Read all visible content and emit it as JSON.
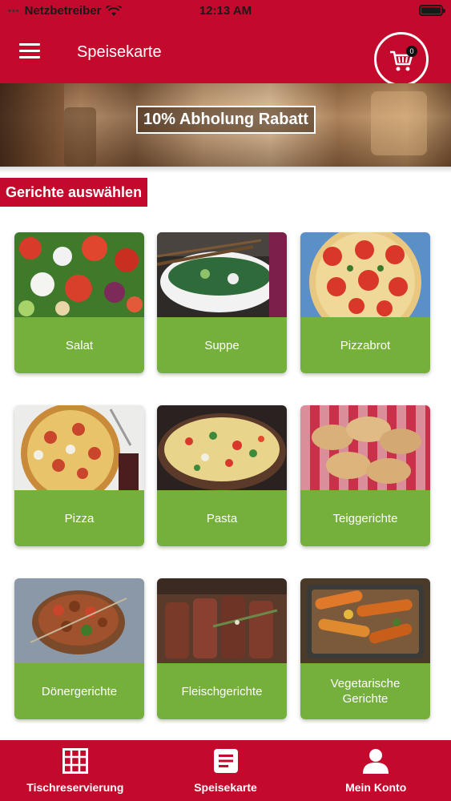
{
  "status_bar": {
    "carrier": "Netzbetreiber",
    "time": "12:13 AM"
  },
  "header": {
    "title": "Speisekarte",
    "cart_count": "0"
  },
  "banner": {
    "text": "10% Abholung Rabatt"
  },
  "section": {
    "label": "Gerichte auswählen"
  },
  "categories": [
    {
      "label": "Salat"
    },
    {
      "label": "Suppe"
    },
    {
      "label": "Pizzabrot"
    },
    {
      "label": "Pizza"
    },
    {
      "label": "Pasta"
    },
    {
      "label": "Teiggerichte"
    },
    {
      "label": "Dönergerichte"
    },
    {
      "label": "Fleischgerichte"
    },
    {
      "label": "Vegetarische Gerichte"
    }
  ],
  "bottom_nav": [
    {
      "label": "Tischreservierung",
      "icon": "grid-icon"
    },
    {
      "label": "Speisekarte",
      "icon": "menu-list-icon"
    },
    {
      "label": "Mein Konto",
      "icon": "user-icon"
    }
  ],
  "colors": {
    "brand": "#c30a2c",
    "accent": "#76b03c"
  }
}
